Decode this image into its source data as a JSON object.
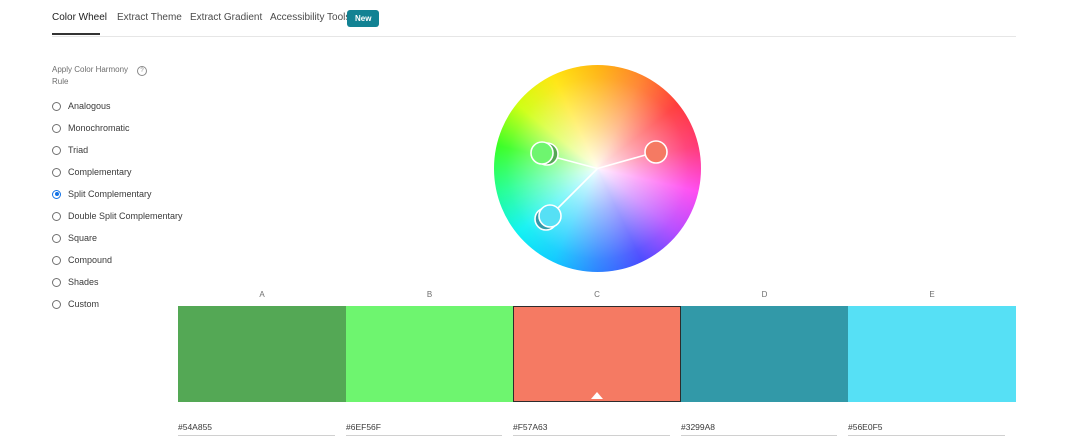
{
  "tabs": [
    {
      "label": "Color Wheel",
      "active": true
    },
    {
      "label": "Extract Theme",
      "active": false
    },
    {
      "label": "Extract Gradient",
      "active": false
    },
    {
      "label": "Accessibility Tools",
      "active": false
    }
  ],
  "new_badge": "New",
  "harmony": {
    "title": "Apply Color Harmony Rule",
    "help_icon": "question-circle-icon",
    "rules": [
      {
        "label": "Analogous",
        "selected": false
      },
      {
        "label": "Monochromatic",
        "selected": false
      },
      {
        "label": "Triad",
        "selected": false
      },
      {
        "label": "Complementary",
        "selected": false
      },
      {
        "label": "Split Complementary",
        "selected": true
      },
      {
        "label": "Double Split Complementary",
        "selected": false
      },
      {
        "label": "Square",
        "selected": false
      },
      {
        "label": "Compound",
        "selected": false
      },
      {
        "label": "Shades",
        "selected": false
      },
      {
        "label": "Custom",
        "selected": false
      }
    ]
  },
  "swatches": [
    {
      "letter": "A",
      "hex": "#54A855",
      "color": "#54A855",
      "selected": false
    },
    {
      "letter": "B",
      "hex": "#6EF56F",
      "color": "#6EF56F",
      "selected": false
    },
    {
      "letter": "C",
      "hex": "#F57A63",
      "color": "#F57A63",
      "selected": true
    },
    {
      "letter": "D",
      "hex": "#3299A8",
      "color": "#3299A8",
      "selected": false
    },
    {
      "letter": "E",
      "hex": "#56E0F5",
      "color": "#56E0F5",
      "selected": false
    }
  ],
  "colors": {
    "accent": "#1473E6",
    "badge": "#128293"
  }
}
